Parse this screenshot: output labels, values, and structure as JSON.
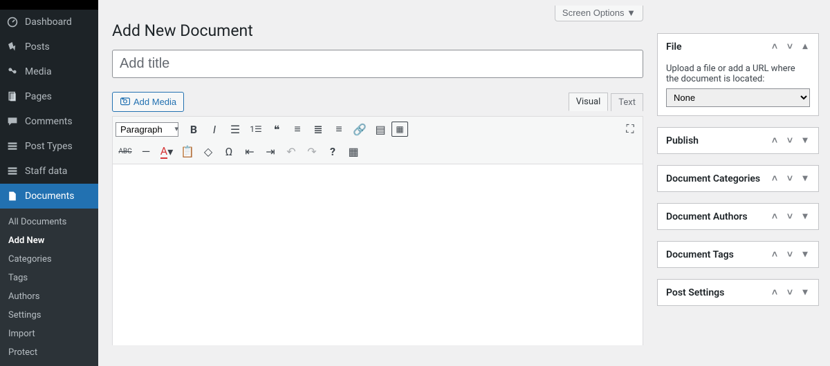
{
  "screenOptions": "Screen Options ▼",
  "pageTitle": "Add New Document",
  "titlePlaceholder": "Add title",
  "addMedia": "Add Media",
  "tabs": {
    "visual": "Visual",
    "text": "Text"
  },
  "formatDropdown": "Paragraph",
  "sidebar": {
    "items": [
      {
        "label": "Dashboard"
      },
      {
        "label": "Posts"
      },
      {
        "label": "Media"
      },
      {
        "label": "Pages"
      },
      {
        "label": "Comments"
      },
      {
        "label": "Post Types"
      },
      {
        "label": "Staff data"
      },
      {
        "label": "Documents"
      }
    ],
    "submenu": [
      {
        "label": "All Documents"
      },
      {
        "label": "Add New"
      },
      {
        "label": "Categories"
      },
      {
        "label": "Tags"
      },
      {
        "label": "Authors"
      },
      {
        "label": "Settings"
      },
      {
        "label": "Import"
      },
      {
        "label": "Protect"
      }
    ]
  },
  "metaboxes": {
    "file": {
      "title": "File",
      "help": "Upload a file or add a URL where the document is located:",
      "selected": "None"
    },
    "publish": {
      "title": "Publish"
    },
    "categories": {
      "title": "Document Categories"
    },
    "authors": {
      "title": "Document Authors"
    },
    "tags": {
      "title": "Document Tags"
    },
    "postSettings": {
      "title": "Post Settings"
    }
  }
}
